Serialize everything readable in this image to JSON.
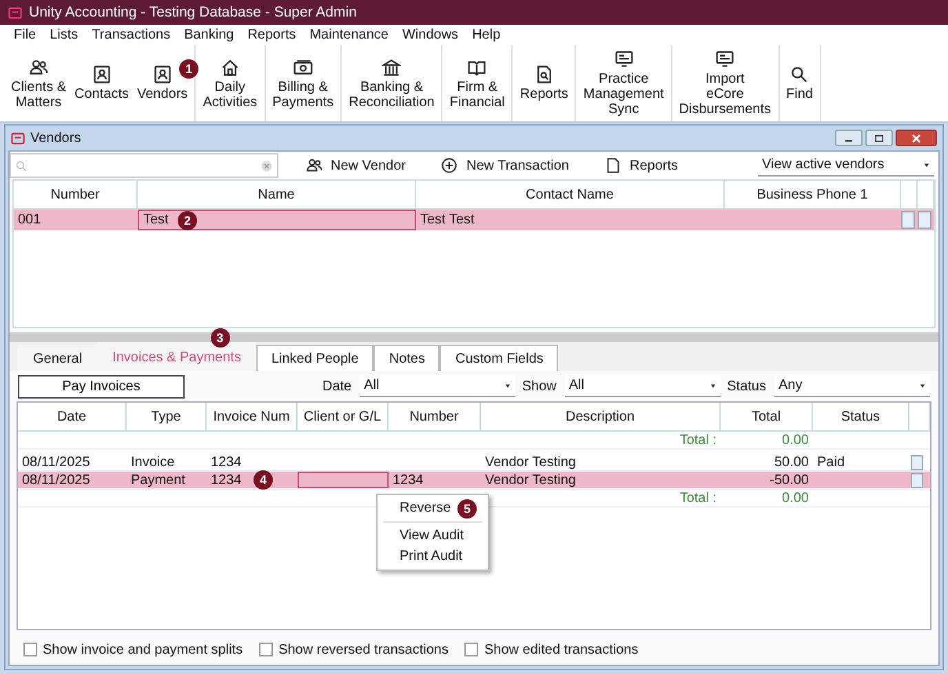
{
  "window": {
    "title": "Unity Accounting - Testing Database - Super Admin"
  },
  "menu": [
    "File",
    "Lists",
    "Transactions",
    "Banking",
    "Reports",
    "Maintenance",
    "Windows",
    "Help"
  ],
  "toolbar": [
    [
      {
        "label": "Clients &\nMatters"
      },
      {
        "label": "Contacts"
      },
      {
        "label": "Vendors",
        "badge": "1"
      }
    ],
    [
      {
        "label": "Daily\nActivities"
      }
    ],
    [
      {
        "label": "Billing &\nPayments"
      }
    ],
    [
      {
        "label": "Banking &\nReconciliation"
      }
    ],
    [
      {
        "label": "Firm &\nFinancial"
      }
    ],
    [
      {
        "label": "Reports"
      }
    ],
    [
      {
        "label": "Practice\nManagement\nSync"
      }
    ],
    [
      {
        "label": "Import\neCore\nDisbursements"
      }
    ],
    [
      {
        "label": "Find"
      }
    ]
  ],
  "vendors": {
    "title": "Vendors",
    "actions": [
      "New Vendor",
      "New Transaction",
      "Reports"
    ],
    "view": "View active vendors",
    "columns": [
      "Number",
      "Name",
      "Contact Name",
      "Business Phone 1"
    ],
    "rows": [
      {
        "cells": [
          "001",
          "Test",
          "Test Test",
          ""
        ],
        "selected": true,
        "badge": "2"
      }
    ],
    "tabs": [
      {
        "label": "General",
        "selected": false
      },
      {
        "label": "Invoices & Payments",
        "selected": true,
        "badge": "3"
      },
      {
        "label": "Linked People",
        "selected": false
      },
      {
        "label": "Notes",
        "selected": false
      },
      {
        "label": "Custom Fields",
        "selected": false
      }
    ],
    "pay_button": "Pay Invoices",
    "filters": [
      {
        "label": "Date",
        "value": "All"
      },
      {
        "label": "Show",
        "value": "All"
      },
      {
        "label": "Status",
        "value": "Any"
      }
    ],
    "transactions": {
      "columns": [
        "Date",
        "Type",
        "Invoice Num",
        "Client or G/L",
        "Number",
        "Description",
        "Total",
        "Status"
      ],
      "total_top": {
        "label": "Total :",
        "value": "0.00"
      },
      "rows": [
        {
          "cells": [
            "08/11/2025",
            "Invoice",
            "1234",
            "",
            "",
            "Vendor Testing",
            "50.00",
            "Paid"
          ],
          "selected": false
        },
        {
          "cells": [
            "08/11/2025",
            "Payment",
            "1234",
            "",
            "1234",
            "Vendor Testing",
            "-50.00",
            ""
          ],
          "selected": true,
          "badge": "4"
        }
      ],
      "total_bottom": {
        "label": "Total :",
        "value": "0.00"
      }
    },
    "context_menu": [
      {
        "label": "Reverse",
        "separator_before": false,
        "badge": "5"
      },
      {
        "label": "View Audit",
        "separator_before": true
      },
      {
        "label": "Print Audit",
        "separator_before": false
      }
    ],
    "options": [
      {
        "label": "Show invoice and payment splits",
        "checked": false
      },
      {
        "label": "Show reversed transactions",
        "checked": false
      },
      {
        "label": "Show edited transactions",
        "checked": false
      }
    ]
  }
}
